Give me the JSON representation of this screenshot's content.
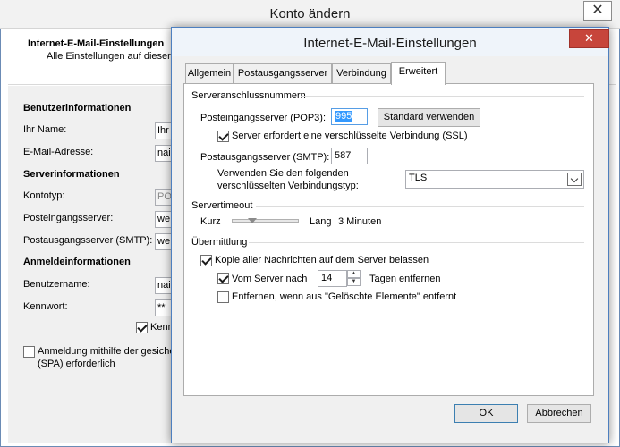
{
  "background": {
    "title": "Konto ändern",
    "close_glyph": "✕",
    "heading": "Internet-E-Mail-Einstellungen",
    "subheading": "Alle Einstellungen auf dieser",
    "sections": {
      "user_info": "Benutzerinformationen",
      "server_info": "Serverinformationen",
      "login_info": "Anmeldeinformationen"
    },
    "fields": {
      "name_label": "Ihr Name:",
      "name_value": "Ihr",
      "email_label": "E-Mail-Adresse:",
      "email_value": "nai",
      "account_type_label": "Kontotyp:",
      "account_type_value": "PO",
      "incoming_label": "Posteingangsserver:",
      "incoming_value": "we",
      "outgoing_label": "Postausgangsserver (SMTP):",
      "outgoing_value": "we",
      "username_label": "Benutzername:",
      "username_value": "nai",
      "password_label": "Kennwort:",
      "password_value": "**",
      "remember_label": "Kenn",
      "spa_label_line1": "Anmeldung mithilfe der gesiche",
      "spa_label_line2": "(SPA) erforderlich"
    }
  },
  "dialog": {
    "title": "Internet-E-Mail-Einstellungen",
    "tabs": [
      "Allgemein",
      "Postausgangsserver",
      "Verbindung",
      "Erweitert"
    ],
    "active_tab": "Erweitert",
    "server_ports": {
      "group_label": "Serveranschlussnummern",
      "pop3_label": "Posteingangsserver (POP3):",
      "pop3_value": "995",
      "default_button": "Standard verwenden",
      "ssl_label": "Server erfordert eine verschlüsselte Verbindung (SSL)",
      "ssl_checked": true,
      "smtp_label": "Postausgangsserver (SMTP):",
      "smtp_value": "587",
      "encryption_label_line1": "Verwenden Sie den folgenden",
      "encryption_label_line2": "verschlüsselten Verbindungstyp:",
      "encryption_value": "TLS"
    },
    "timeout": {
      "group_label": "Servertimeout",
      "short_label": "Kurz",
      "long_label": "Lang",
      "value": "3 Minuten",
      "slider_fraction": 0.3
    },
    "delivery": {
      "group_label": "Übermittlung",
      "keep_copy_label": "Kopie aller Nachrichten auf dem Server belassen",
      "keep_copy_checked": true,
      "remove_after_label": "Vom Server nach",
      "remove_after_checked": true,
      "days_value": "14",
      "days_suffix": "Tagen entfernen",
      "remove_deleted_label": "Entfernen, wenn aus \"Gelöschte Elemente\" entfernt",
      "remove_deleted_checked": false
    },
    "buttons": {
      "ok": "OK",
      "cancel": "Abbrechen"
    }
  }
}
